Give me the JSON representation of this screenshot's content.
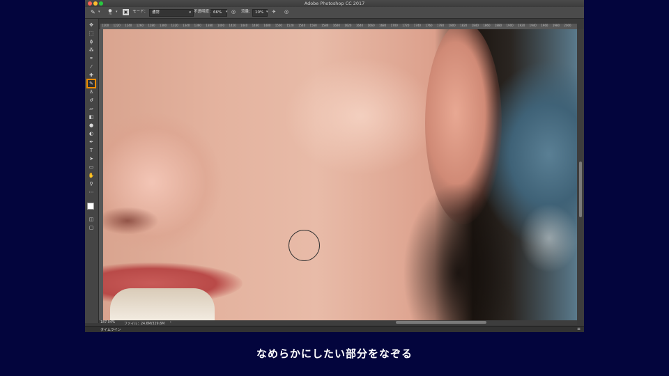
{
  "app": {
    "title": "Adobe Photoshop CC 2017"
  },
  "colors": {
    "background": "#03053d",
    "selected_tool_outline": "#f08c00",
    "close": "#ff5f57",
    "minimize": "#febc2e",
    "zoom": "#28c840"
  },
  "options_bar": {
    "brush_size": "70",
    "mode_label": "モード：",
    "mode_value": "通常",
    "opacity_label": "不透明度：",
    "opacity_value": "66%",
    "flow_label": "流量：",
    "flow_value": "10%"
  },
  "ruler_ticks": [
    "1200",
    "1220",
    "1240",
    "1260",
    "1280",
    "1300",
    "1320",
    "1340",
    "1360",
    "1380",
    "1400",
    "1420",
    "1440",
    "1460",
    "1480",
    "1500",
    "1520",
    "1540",
    "1560",
    "1580",
    "1600",
    "1620",
    "1640",
    "1660",
    "1680",
    "1700",
    "1720",
    "1740",
    "1760",
    "1780",
    "1800",
    "1820",
    "1840",
    "1860",
    "1880",
    "1900",
    "1920",
    "1940",
    "1960",
    "1980",
    "2000"
  ],
  "tools": [
    {
      "name": "move-tool-icon",
      "glyph": "✥"
    },
    {
      "name": "marquee-tool-icon",
      "glyph": "⬚"
    },
    {
      "name": "lasso-tool-icon",
      "glyph": "ϕ"
    },
    {
      "name": "magic-wand-tool-icon",
      "glyph": "⁂"
    },
    {
      "name": "crop-tool-icon",
      "glyph": "⌗"
    },
    {
      "name": "eyedropper-tool-icon",
      "glyph": "⁄"
    },
    {
      "name": "healing-brush-tool-icon",
      "glyph": "✚"
    },
    {
      "name": "brush-tool-icon",
      "glyph": "✎",
      "selected": true
    },
    {
      "name": "clone-stamp-tool-icon",
      "glyph": "♙"
    },
    {
      "name": "history-brush-tool-icon",
      "glyph": "↺"
    },
    {
      "name": "eraser-tool-icon",
      "glyph": "▱"
    },
    {
      "name": "gradient-tool-icon",
      "glyph": "◧"
    },
    {
      "name": "blur-tool-icon",
      "glyph": "●"
    },
    {
      "name": "dodge-tool-icon",
      "glyph": "◐"
    },
    {
      "name": "pen-tool-icon",
      "glyph": "✒"
    },
    {
      "name": "type-tool-icon",
      "glyph": "T"
    },
    {
      "name": "path-selection-tool-icon",
      "glyph": "➤"
    },
    {
      "name": "rectangle-tool-icon",
      "glyph": "▭"
    },
    {
      "name": "hand-tool-icon",
      "glyph": "✋"
    },
    {
      "name": "zoom-tool-icon",
      "glyph": "⚲"
    },
    {
      "name": "more-tools-icon",
      "glyph": "⋯"
    }
  ],
  "status": {
    "zoom": "187.04%",
    "file_info": "ファイル：24.6M/329.6M"
  },
  "timeline": {
    "label": "タイムライン"
  },
  "caption": "なめらかにしたい部分をなぞる"
}
